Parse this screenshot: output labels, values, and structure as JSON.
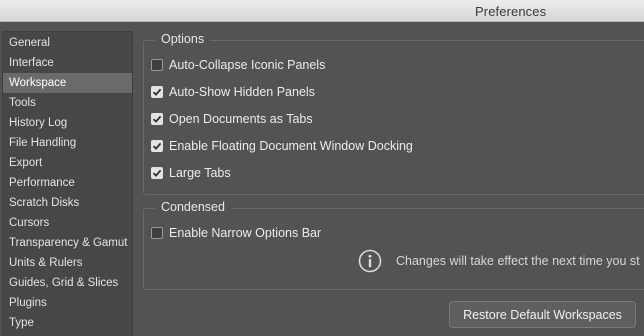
{
  "window": {
    "title": "Preferences"
  },
  "sidebar": {
    "items": [
      {
        "label": "General"
      },
      {
        "label": "Interface"
      },
      {
        "label": "Workspace",
        "selected": true
      },
      {
        "label": "Tools"
      },
      {
        "label": "History Log"
      },
      {
        "label": "File Handling"
      },
      {
        "label": "Export"
      },
      {
        "label": "Performance"
      },
      {
        "label": "Scratch Disks"
      },
      {
        "label": "Cursors"
      },
      {
        "label": "Transparency & Gamut"
      },
      {
        "label": "Units & Rulers"
      },
      {
        "label": "Guides, Grid & Slices"
      },
      {
        "label": "Plugins"
      },
      {
        "label": "Type"
      }
    ]
  },
  "options": {
    "legend": "Options",
    "items": [
      {
        "label": "Auto-Collapse Iconic Panels",
        "checked": false
      },
      {
        "label": "Auto-Show Hidden Panels",
        "checked": true
      },
      {
        "label": "Open Documents as Tabs",
        "checked": true
      },
      {
        "label": "Enable Floating Document Window Docking",
        "checked": true
      },
      {
        "label": "Large Tabs",
        "checked": true
      }
    ]
  },
  "condensed": {
    "legend": "Condensed",
    "items": [
      {
        "label": "Enable Narrow Options Bar",
        "checked": false
      }
    ],
    "info_text": "Changes will take effect the next time you st"
  },
  "buttons": {
    "restore_label": "Restore Default Workspaces"
  },
  "colors": {
    "selected_item": "#6a6a6a",
    "panel_bg": "#535353",
    "sidebar_bg": "#474747"
  }
}
